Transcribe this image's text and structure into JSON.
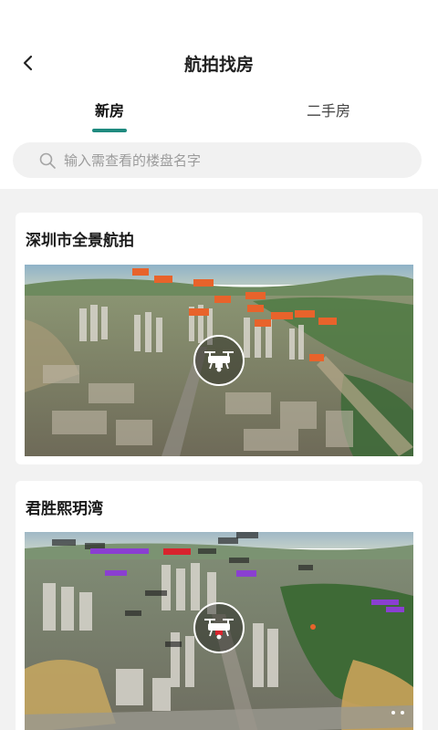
{
  "header": {
    "title": "航拍找房"
  },
  "tabs": [
    {
      "label": "新房",
      "active": true
    },
    {
      "label": "二手房",
      "active": false
    }
  ],
  "search": {
    "placeholder": "输入需查看的楼盘名字",
    "value": ""
  },
  "cards": [
    {
      "title": "深圳市全景航拍"
    },
    {
      "title": "君胜熙玥湾"
    }
  ],
  "colors": {
    "accent": "#1f8a7f",
    "page_background": "#f2f2f2",
    "search_background": "#f1f1f1",
    "tag_orange": "#e8632b",
    "tag_purple": "#8a3fd1",
    "tag_red": "#d8242d"
  },
  "icons": {
    "back": "chevron-left-icon",
    "search": "search-icon",
    "aerial_play": "drone-icon"
  }
}
